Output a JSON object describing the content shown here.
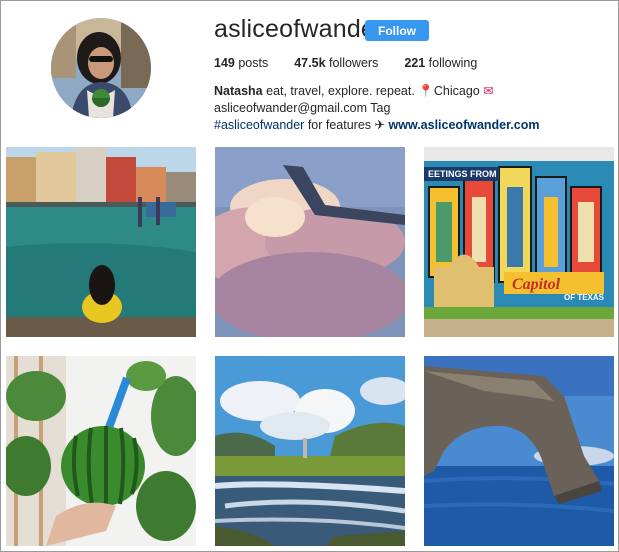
{
  "profile": {
    "username": "asliceofwander",
    "follow_label": "Follow",
    "stats": {
      "posts_count": "149",
      "posts_label": "posts",
      "followers_count": "47.5k",
      "followers_label": "followers",
      "following_count": "221",
      "following_label": "following"
    },
    "bio": {
      "name": "Natasha",
      "text1": " eat, travel, explore. repeat. ",
      "location": "Chicago",
      "email": " asliceofwander@gmail.com Tag",
      "hashtag": "#asliceofwander",
      "text2": " for features ",
      "url": "www.asliceofwander.com"
    }
  },
  "posts": [
    {
      "name": "venice-canal-photo"
    },
    {
      "name": "clouds-airplane-wing-photo"
    },
    {
      "name": "greetings-from-austin-mural-photo"
    },
    {
      "name": "watermelon-drink-photo"
    },
    {
      "name": "river-valley-landscape-photo"
    },
    {
      "name": "azure-window-rock-arch-photo"
    }
  ]
}
